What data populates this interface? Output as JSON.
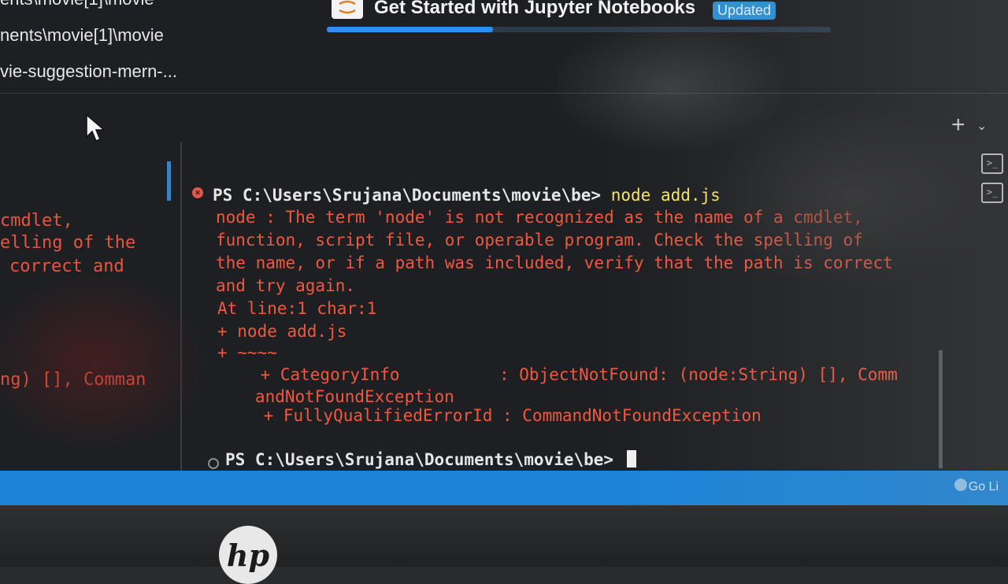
{
  "explorer": {
    "items": [
      {
        "label": "ents\\movie[1]\\movie"
      },
      {
        "label": "nents\\movie[1]\\movie"
      },
      {
        "label": "vie-suggestion-mern-..."
      }
    ]
  },
  "tab": {
    "title": "Get Started with Jupyter Notebooks",
    "badge": "Updated",
    "progress": 0.33
  },
  "left_pane": {
    "lines": [
      "cmdlet,",
      "elling of the",
      "correct and",
      "ng) [], Comman"
    ]
  },
  "terminal": {
    "prompt1": "PS C:\\Users\\Srujana\\Documents\\movie\\be> ",
    "command": "node add.js",
    "error_lines": [
      "node : The term 'node' is not recognized as the name of a cmdlet,",
      "function, script file, or operable program. Check the spelling of",
      "the name, or if a path was included, verify that the path is correct",
      "and try again.",
      "At line:1 char:1",
      "+ node add.js",
      "+ ~~~~",
      "    + CategoryInfo          : ObjectNotFound: (node:String) [], Comm",
      "   andNotFoundException",
      "    + FullyQualifiedErrorId : CommandNotFoundException"
    ],
    "prompt2": "PS C:\\Users\\Srujana\\Documents\\movie\\be> "
  },
  "status_bar": {
    "right_text": "Go Li",
    "color": "#1b84d8"
  },
  "icons": {
    "tab": "jupyter-icon",
    "plus": "plus-icon",
    "chevron": "chevron-down-icon",
    "terminal_a": "terminal-icon",
    "terminal_b": "terminal-icon"
  },
  "hardware": {
    "logo": "hp"
  },
  "colors": {
    "error": "#f0583f",
    "command": "#f5e66a",
    "accent": "#2f8ef0"
  }
}
